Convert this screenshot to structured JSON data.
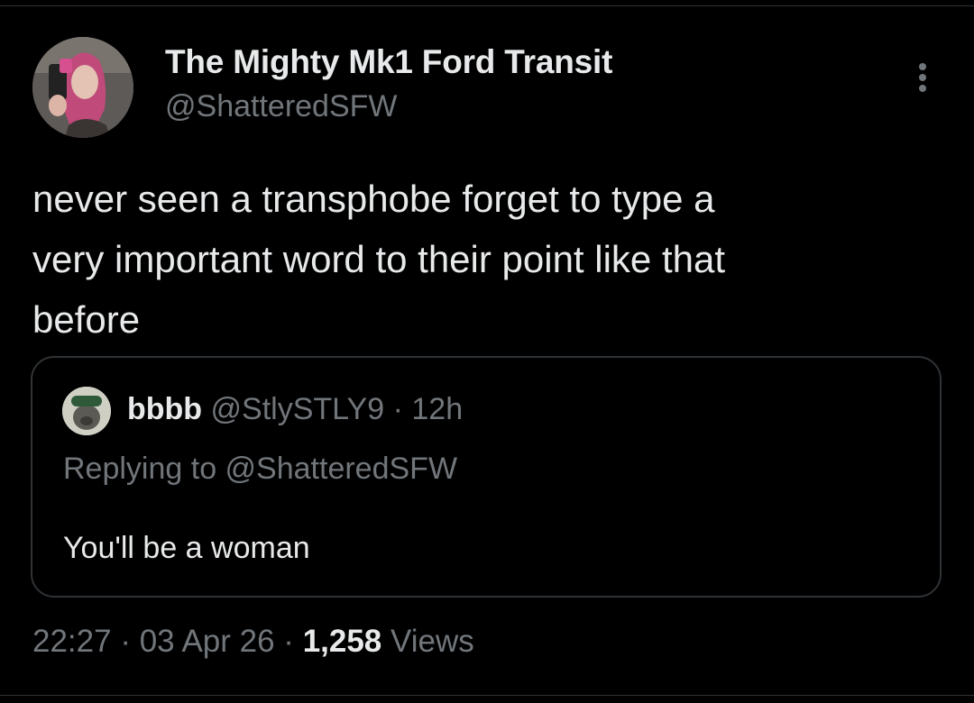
{
  "author": {
    "display_name": "The Mighty Mk1 Ford Transit",
    "handle": "@ShatteredSFW"
  },
  "tweet": {
    "text": "never seen a transphobe forget to type a\nvery important word to their point like that\nbefore"
  },
  "quoted": {
    "name": "bbbb",
    "handle": "@StlySTLY9",
    "separator": "·",
    "time": "12h",
    "replying_prefix": "Replying to ",
    "replying_to": "@ShatteredSFW",
    "text": "You'll be a woman"
  },
  "meta": {
    "time": "22:27",
    "separator": "·",
    "date": "03 Apr 26",
    "views_count": "1,258",
    "views_label": "Views"
  },
  "icons": {
    "more": "more-dots-icon"
  },
  "colors": {
    "background": "#000000",
    "primary_text": "#e7e9ea",
    "secondary_text": "#71767b",
    "border": "#2f3336"
  }
}
